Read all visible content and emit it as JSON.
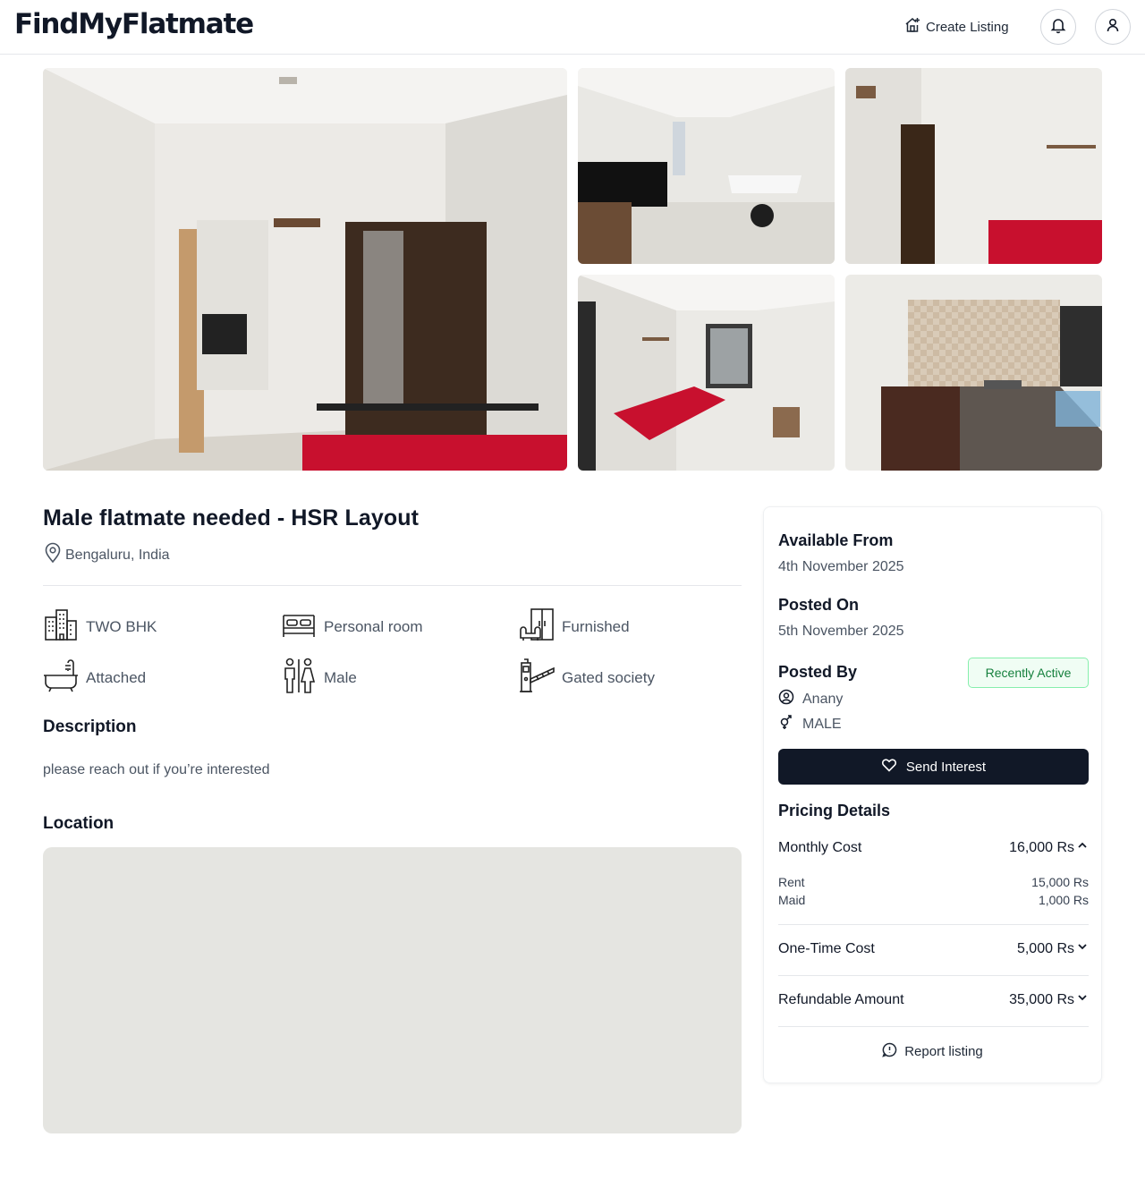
{
  "header": {
    "logo": "FindMyFlatmate",
    "create_listing": "Create Listing"
  },
  "listing": {
    "title": "Male flatmate needed - HSR Layout",
    "location": "Bengaluru, India",
    "features": [
      {
        "icon": "building-icon",
        "label": "TWO BHK"
      },
      {
        "icon": "bed-icon",
        "label": "Personal room"
      },
      {
        "icon": "wardrobe-icon",
        "label": "Furnished"
      },
      {
        "icon": "bathtub-icon",
        "label": "Attached"
      },
      {
        "icon": "male-female-icon",
        "label": "Male"
      },
      {
        "icon": "gate-barrier-icon",
        "label": "Gated society"
      }
    ],
    "description_heading": "Description",
    "description": "please reach out if you’re interested",
    "location_heading": "Location"
  },
  "details": {
    "available_from_label": "Available From",
    "available_from": "4th November 2025",
    "posted_on_label": "Posted On",
    "posted_on": "5th November 2025",
    "posted_by_label": "Posted By",
    "badge": "Recently Active",
    "poster_name": "Anany",
    "poster_gender": "MALE",
    "send_interest": "Send Interest"
  },
  "pricing": {
    "heading": "Pricing Details",
    "monthly_label": "Monthly Cost",
    "monthly_value": "16,000 Rs",
    "breakdown": [
      {
        "label": "Rent",
        "value": "15,000 Rs"
      },
      {
        "label": "Maid",
        "value": "1,000 Rs"
      }
    ],
    "one_time_label": "One-Time Cost",
    "one_time_value": "5,000 Rs",
    "refundable_label": "Refundable Amount",
    "refundable_value": "35,000 Rs",
    "report": "Report listing"
  },
  "colors": {
    "primary_button": "#111827",
    "badge_border": "#86efac",
    "badge_text": "#15803d",
    "map_placeholder": "#e5e5e1",
    "bedsheet": "#c8102e"
  }
}
